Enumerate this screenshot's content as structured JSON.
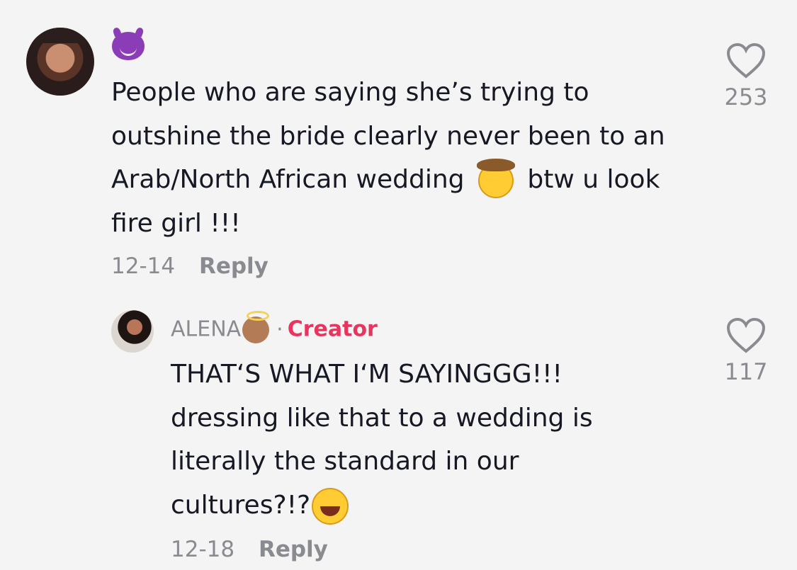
{
  "comment": {
    "text_before_emoji": "People who are saying she’s trying to outshine the bride clearly never been to an Arab/North African wedding",
    "text_after_emoji": "btw u look fire girl !!!",
    "date": "12-14",
    "reply_label": "Reply",
    "like_count": "253",
    "icons": [
      "avatar",
      "devil-emoji",
      "cowboy-emoji",
      "heart-icon"
    ]
  },
  "reply": {
    "author": "ALENA",
    "separator": "·",
    "creator_label": "Creator",
    "line1": "THAT‘S WHAT I‘M SAYINGGG!!!",
    "line2": "dressing like that to a wedding is",
    "line3": "literally the standard in our",
    "line4": "cultures?!?",
    "date": "12-18",
    "reply_label": "Reply",
    "like_count": "117",
    "icons": [
      "avatar",
      "angel-emoji",
      "laughing-emoji",
      "heart-icon"
    ]
  },
  "colors": {
    "background": "#f4f4f4",
    "text": "#161823",
    "muted": "#8a8b91",
    "creator_accent": "#e8355f"
  }
}
